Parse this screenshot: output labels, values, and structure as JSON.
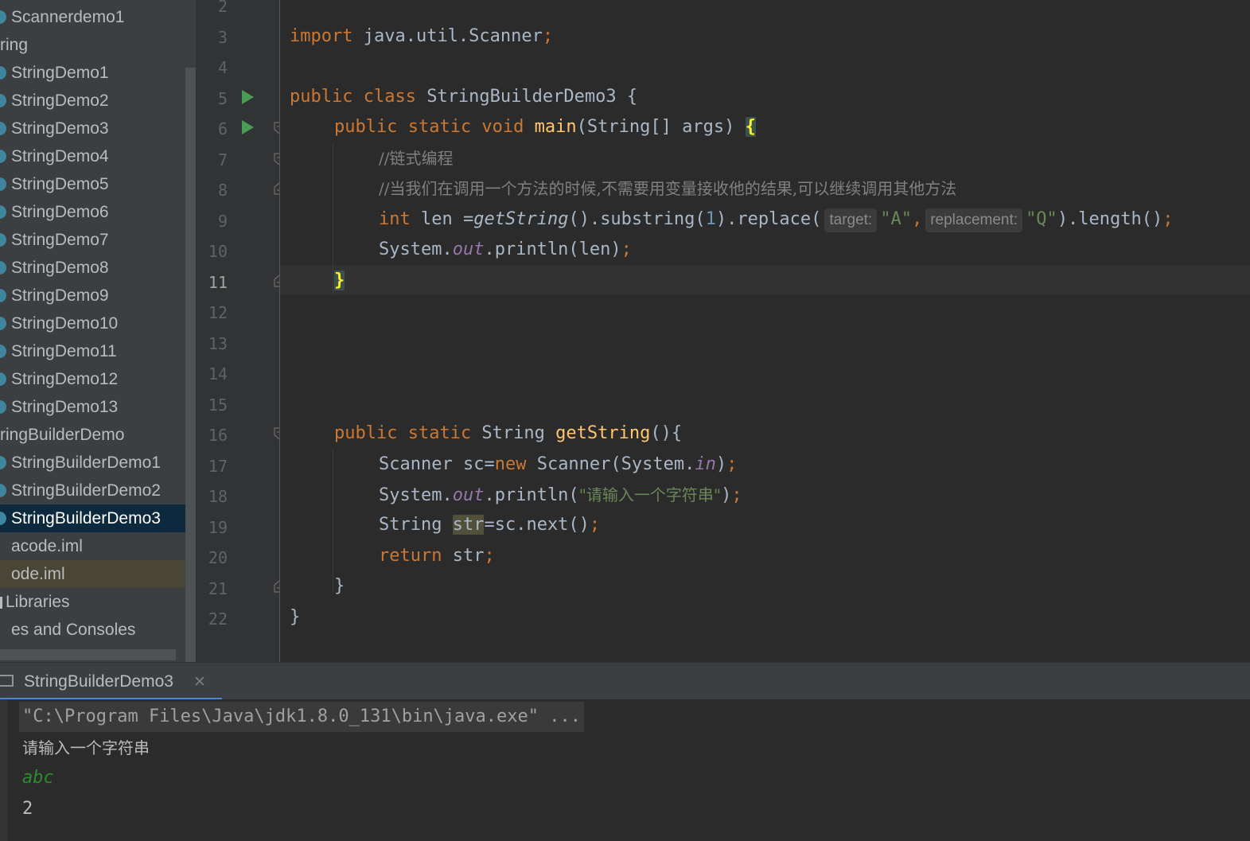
{
  "project_tree": {
    "items": [
      {
        "label": "Scannerdemo1",
        "kind": "class"
      },
      {
        "label": "ring",
        "kind": "folder"
      },
      {
        "label": "StringDemo1",
        "kind": "class"
      },
      {
        "label": "StringDemo2",
        "kind": "class"
      },
      {
        "label": "StringDemo3",
        "kind": "class"
      },
      {
        "label": "StringDemo4",
        "kind": "class"
      },
      {
        "label": "StringDemo5",
        "kind": "class"
      },
      {
        "label": "StringDemo6",
        "kind": "class"
      },
      {
        "label": "StringDemo7",
        "kind": "class"
      },
      {
        "label": "StringDemo8",
        "kind": "class"
      },
      {
        "label": "StringDemo9",
        "kind": "class"
      },
      {
        "label": "StringDemo10",
        "kind": "class"
      },
      {
        "label": "StringDemo11",
        "kind": "class"
      },
      {
        "label": "StringDemo12",
        "kind": "class"
      },
      {
        "label": "StringDemo13",
        "kind": "class"
      },
      {
        "label": "ringBuilderDemo",
        "kind": "folder"
      },
      {
        "label": "StringBuilderDemo1",
        "kind": "class"
      },
      {
        "label": "StringBuilderDemo2",
        "kind": "class"
      },
      {
        "label": "StringBuilderDemo3",
        "kind": "class",
        "selected": true
      },
      {
        "label": "acode.iml",
        "kind": "file"
      },
      {
        "label": "ode.iml",
        "kind": "file",
        "highlighted": true
      },
      {
        "label": "Libraries",
        "kind": "lib"
      },
      {
        "label": "es and Consoles",
        "kind": "file"
      }
    ]
  },
  "editor": {
    "line_numbers": [
      "2",
      "3",
      "4",
      "5",
      "6",
      "7",
      "8",
      "9",
      "10",
      "11",
      "12",
      "13",
      "14",
      "15",
      "16",
      "17",
      "18",
      "19",
      "20",
      "21",
      "22"
    ],
    "current_line": "11",
    "code": {
      "l3": {
        "kw": "import",
        "rest": " java.util.Scanner",
        "semi": ";"
      },
      "l5": {
        "kw": "public class",
        "rest": " StringBuilderDemo3 {"
      },
      "l6": {
        "kw": "public static void",
        "fn": "main",
        "rest": "(String[] args) ",
        "brace": "{"
      },
      "l7": {
        "comment": "//链式编程"
      },
      "l8": {
        "comment": "//当我们在调用一个方法的时候,不需要用变量接收他的结果,可以继续调用其他方法"
      },
      "l9": {
        "kw": "int",
        "a": " len =",
        "method_italic": "getString",
        "b": "().substring(",
        "num": "1",
        "c": ").replace(",
        "hint1": "target:",
        "str1": "\"A\"",
        "comma": ",",
        "hint2": "replacement:",
        "str2": "\"Q\"",
        "d": ").length()",
        "semi": ";"
      },
      "l10": {
        "a": "System.",
        "field": "out",
        "b": ".println(len)",
        "semi": ";"
      },
      "l11": {
        "brace": "}"
      },
      "l16": {
        "kw": "public static",
        "a": " String ",
        "fn": "getString",
        "b": "(){"
      },
      "l17": {
        "a": "Scanner sc=",
        "kw": "new",
        "b": " Scanner(System.",
        "field": "in",
        "c": ")",
        "semi": ";"
      },
      "l18": {
        "a": "System.",
        "field": "out",
        "b": ".println(",
        "str": "\"请输入一个字符串\"",
        "c": ")",
        "semi": ";"
      },
      "l19": {
        "a": "String ",
        "var": "str",
        "b": "=sc.next()",
        "semi": ";"
      },
      "l20": {
        "kw": "return",
        "a": " str",
        "semi": ";"
      },
      "l21": {
        "a": "}"
      },
      "l22": {
        "a": "}"
      }
    }
  },
  "run_panel": {
    "tab_label": "StringBuilderDemo3",
    "close_glyph": "✕",
    "console_lines": {
      "cmd": "\"C:\\Program Files\\Java\\jdk1.8.0_131\\bin\\java.exe\" ...",
      "prompt": "请输入一个字符串",
      "input": "abc",
      "output": "2"
    }
  },
  "colors": {
    "keyword": "#cc7832",
    "function": "#ffc66d",
    "string": "#6a8759",
    "number": "#6897bb",
    "comment": "#808080",
    "field": "#9876aa",
    "selection": "#0d293e",
    "run_icon": "#499c54"
  }
}
